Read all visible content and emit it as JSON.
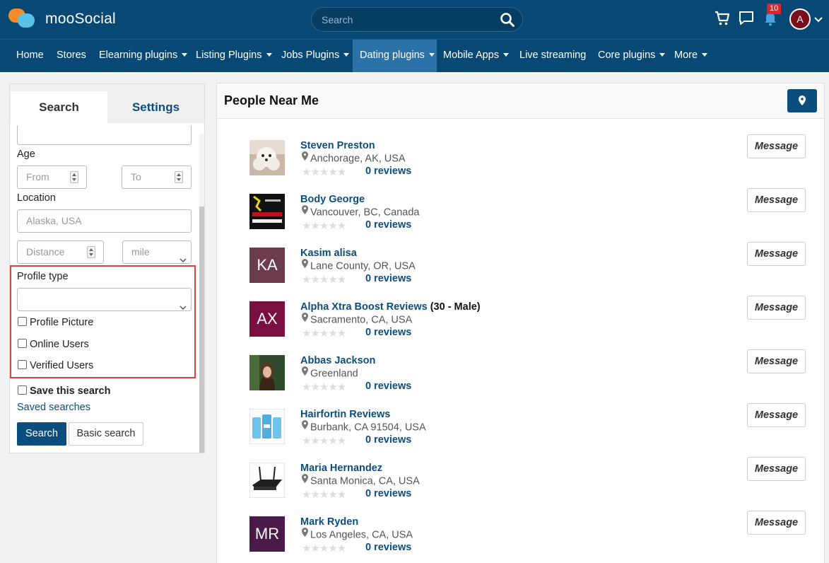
{
  "header": {
    "logo_text": "mooSocial",
    "search_placeholder": "Search",
    "notification_count": "10",
    "user_initial": "A"
  },
  "nav": {
    "items": [
      {
        "label": "Home",
        "has_caret": false
      },
      {
        "label": "Stores",
        "has_caret": false
      },
      {
        "label": "Elearning plugins",
        "has_caret": true
      },
      {
        "label": "Listing Plugins",
        "has_caret": true
      },
      {
        "label": "Jobs Plugins",
        "has_caret": true
      },
      {
        "label": "Dating plugins",
        "has_caret": true,
        "active": true
      },
      {
        "label": "Mobile Apps",
        "has_caret": true
      },
      {
        "label": "Live streaming",
        "has_caret": false
      },
      {
        "label": "Core plugins",
        "has_caret": true
      },
      {
        "label": "More",
        "has_caret": true
      }
    ]
  },
  "sidebar": {
    "tab_search": "Search",
    "tab_settings": "Settings",
    "age_label": "Age",
    "age_from_placeholder": "From",
    "age_to_placeholder": "To",
    "location_label": "Location",
    "location_placeholder": "Alaska, USA",
    "distance_placeholder": "Distance",
    "unit_value": "mile",
    "profile_type_label": "Profile type",
    "profile_type_value": "",
    "chk_profile_picture": "Profile Picture",
    "chk_online_users": "Online Users",
    "chk_verified_users": "Verified Users",
    "chk_save_search": "Save this search",
    "saved_searches_link": "Saved searches",
    "search_button": "Search",
    "basic_search_button": "Basic search"
  },
  "main": {
    "title": "People Near Me",
    "message_label": "Message",
    "people": [
      {
        "name": "Steven Preston",
        "extra": "",
        "location": "Anchorage, AK, USA",
        "reviews": "0 reviews",
        "avatar": "photo-dog"
      },
      {
        "name": "Body George",
        "extra": "",
        "location": "Vancouver, BC, Canada",
        "reviews": "0 reviews",
        "avatar": "photo-logo"
      },
      {
        "name": "Kasim alisa",
        "extra": "",
        "location": "Lane County, OR, USA",
        "reviews": "0 reviews",
        "avatar": "KA",
        "avatar_color": "#6b3c4e"
      },
      {
        "name": "Alpha Xtra Boost Reviews",
        "extra": "(30 - Male)",
        "location": "Sacramento, CA, USA",
        "reviews": "0 reviews",
        "avatar": "AX",
        "avatar_color": "#7a1040"
      },
      {
        "name": "Abbas Jackson",
        "extra": "",
        "location": "Greenland",
        "reviews": "0 reviews",
        "avatar": "photo-woman"
      },
      {
        "name": "Hairfortin Reviews",
        "extra": "",
        "location": "Burbank, CA 91504, USA",
        "reviews": "0 reviews",
        "avatar": "photo-bottles"
      },
      {
        "name": "Maria Hernandez",
        "extra": "",
        "location": "Santa Monica, CA, USA",
        "reviews": "0 reviews",
        "avatar": "photo-router"
      },
      {
        "name": "Mark Ryden",
        "extra": "",
        "location": "Los Angeles, CA, USA",
        "reviews": "0 reviews",
        "avatar": "MR",
        "avatar_color": "#4a1a48"
      }
    ]
  },
  "colors": {
    "header_bg": "#074875",
    "nav_active": "#2b72a8",
    "link": "#0b4d7d",
    "highlight": "#e04040"
  }
}
